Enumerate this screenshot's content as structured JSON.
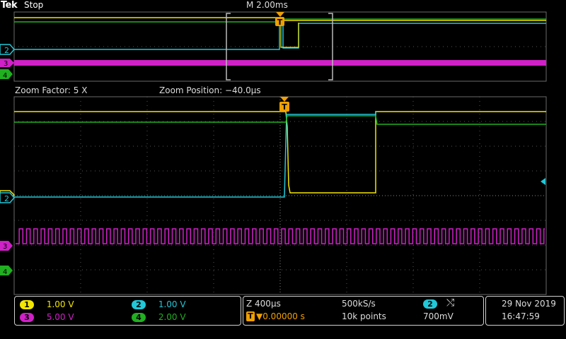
{
  "header": {
    "brand": "Tek",
    "state": "Stop",
    "timebase": "M 2.00ms"
  },
  "zoom": {
    "factor": "Zoom Factor: 5 X",
    "position": "Zoom Position: −40.0µs"
  },
  "markers": {
    "trigger": "T",
    "ch1": "1",
    "ch2": "2",
    "ch3": "3",
    "ch4": "4"
  },
  "channels": [
    {
      "num": "1",
      "scale": "1.00 V",
      "color": "#f2e600"
    },
    {
      "num": "2",
      "scale": "1.00 V",
      "color": "#20c8d8"
    },
    {
      "num": "3",
      "scale": "5.00 V",
      "color": "#d020c8"
    },
    {
      "num": "4",
      "scale": "2.00 V",
      "color": "#20b020"
    }
  ],
  "horizontal": {
    "zoom_time": "Z 400µs",
    "sample_rate": "500kS/s",
    "trigger_pos": "▼0.00000 s",
    "record": "10k points"
  },
  "trigger": {
    "source": "2",
    "slope_icon": "rising-edge-icon",
    "level": "700mV"
  },
  "datetime": {
    "date": "29 Nov 2019",
    "time": "16:47:59"
  }
}
